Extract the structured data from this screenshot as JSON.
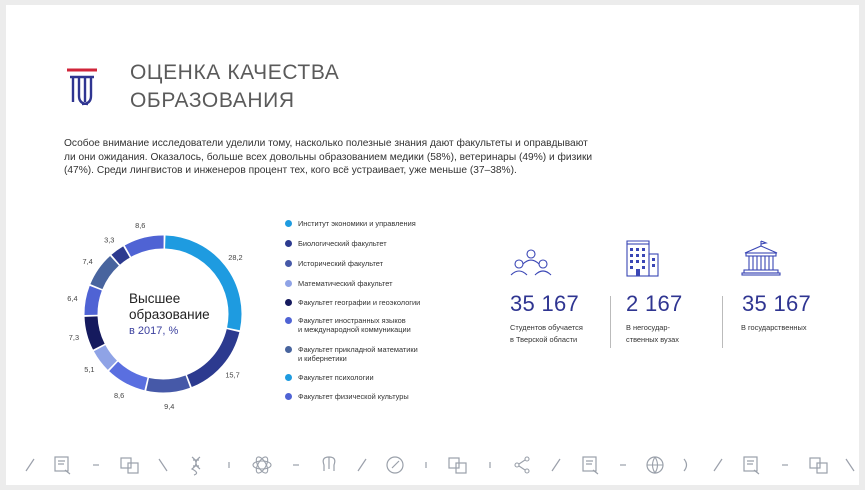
{
  "title": [
    "ОЦЕНКА КАЧЕСТВА",
    "ОБРАЗОВАНИЯ"
  ],
  "intro": [
    "Особое внимание исследователи уделили тому, насколько полезные знания дают факультеты и оправдывают",
    "ли они ожидания. Оказалось, больше всех довольны образованием медики (58%), ветеринары (49%) и физики",
    "(47%). Среди лингвистов и инженеров процент тех, кого всё устраивает, уже меньше (37–38%)."
  ],
  "colors": {
    "accent": "#2f3591",
    "logo_red": "#d0253a",
    "icon": "#3a46b5"
  },
  "chart_data": {
    "type": "pie",
    "subtype": "donut",
    "center_title": [
      "Высшее",
      "образование"
    ],
    "center_subtitle": "в 2017, %",
    "values": [
      28.2,
      15.7,
      9.4,
      8.6,
      5.1,
      7.3,
      6.4,
      7.4,
      3.3,
      8.6
    ],
    "labels": [
      "28,2",
      "15,7",
      "9,4",
      "8,6",
      "5,1",
      "7,3",
      "6,4",
      "7,4",
      "3,3",
      "8,6"
    ],
    "colors": [
      "#1e9be0",
      "#2c3a8f",
      "#4659a8",
      "#5a6fe0",
      "#8fa3e6",
      "#151a5e",
      "#4f63d4",
      "#48649e",
      "#2c3a8f",
      "#4f63d4"
    ],
    "legend": [
      {
        "label": [
          "Институт экономики и управления"
        ],
        "color": "#1e9be0"
      },
      {
        "label": [
          "Биологический факультет"
        ],
        "color": "#2c3a8f"
      },
      {
        "label": [
          "Исторический факультет"
        ],
        "color": "#4659a8"
      },
      {
        "label": [
          "Математический факультет"
        ],
        "color": "#8fa3e6"
      },
      {
        "label": [
          "Факультет географии и геоэкологии"
        ],
        "color": "#151a5e"
      },
      {
        "label": [
          "Факультет иностранных языков",
          "и международной коммуникации"
        ],
        "color": "#4f63d4"
      },
      {
        "label": [
          "Факультет прикладной математики",
          "и кибернетики"
        ],
        "color": "#48649e"
      },
      {
        "label": [
          "Факультет психологии"
        ],
        "color": "#1e9be0"
      },
      {
        "label": [
          "Факультет физической культуры"
        ],
        "color": "#4f63d4"
      }
    ]
  },
  "stats": [
    {
      "value": "35 167",
      "caption": [
        "Студентов обучается",
        "в Тверской области"
      ],
      "icon": "people-icon"
    },
    {
      "value": "2 167",
      "caption": [
        "В негосудар-",
        "ственных вузах"
      ],
      "icon": "office-building-icon"
    },
    {
      "value": "35 167",
      "caption": [
        "В государственных"
      ],
      "icon": "government-building-icon"
    }
  ],
  "bottom_icons": [
    "slash",
    "certificate-icon",
    "dash",
    "translate-icon",
    "backslash",
    "dna-icon",
    "bar",
    "atom-icon",
    "dash",
    "brain-icon",
    "slash",
    "compass-icon",
    "bar",
    "translate-icon",
    "bar",
    "share-icon",
    "slash",
    "certificate-icon",
    "dash",
    "globe-icon",
    "paren",
    "slash",
    "certificate-icon",
    "dash",
    "translate-icon",
    "backslash"
  ]
}
